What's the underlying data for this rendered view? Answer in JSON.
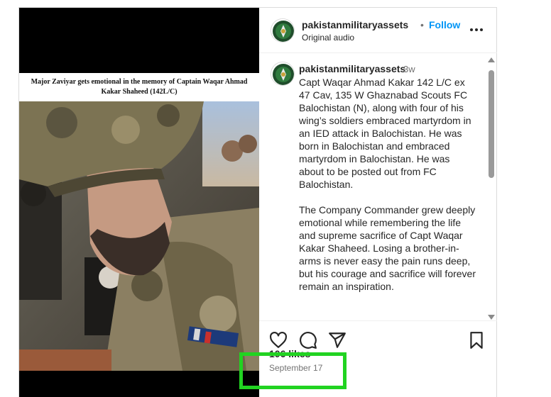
{
  "media": {
    "caption": "Major Zaviyar gets emotional in the memory of Captain Waqar Ahmad Kakar Shaheed (142L/C)"
  },
  "header": {
    "username": "pakistanmilitaryassets",
    "separator": "•",
    "follow_label": "Follow",
    "audio": "Original audio",
    "more_icon": "more-options-icon"
  },
  "caption": {
    "username": "pakistanmilitaryassets",
    "time": "3w",
    "paragraphs": [
      "Capt Waqar Ahmad Kakar 142 L/C ex 47 Cav, 135 W Ghaznabad Scouts FC Balochistan (N), along with four of his wing’s soldiers embraced martyrdom in an IED attack in Balochistan. He was born in Balochistan and embraced martyrdom in Balochistan. He was about to be posted out from FC Balochistan.",
      "The Company Commander grew deeply emotional while remembering the life and supreme sacrifice of Capt Waqar Kakar Shaheed. Losing a brother-in-arms is never easy the pain runs deep, but his courage and sacrifice will forever remain an inspiration."
    ]
  },
  "actions": {
    "icons": [
      "heart-icon",
      "comment-icon",
      "share-icon",
      "bookmark-icon"
    ]
  },
  "likes": "106 likes",
  "date": "September 17",
  "colors": {
    "link_blue": "#0095f6",
    "highlight_green": "#21d321",
    "muted_text": "#737373"
  }
}
